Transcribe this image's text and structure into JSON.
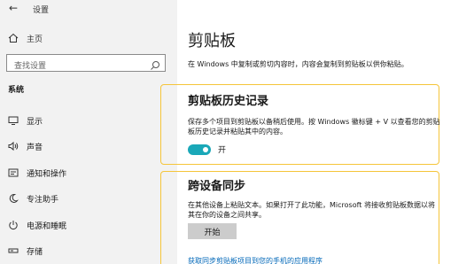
{
  "window": {
    "title": "设置",
    "back_icon": "back-arrow-icon"
  },
  "sidebar": {
    "home_label": "主页",
    "search_placeholder": "查找设置",
    "section_header": "系统",
    "items": [
      {
        "label": "显示",
        "icon": "monitor-icon"
      },
      {
        "label": "声音",
        "icon": "speaker-icon"
      },
      {
        "label": "通知和操作",
        "icon": "notification-icon"
      },
      {
        "label": "专注助手",
        "icon": "moon-icon"
      },
      {
        "label": "电源和睡眠",
        "icon": "power-icon"
      },
      {
        "label": "存储",
        "icon": "storage-icon"
      }
    ]
  },
  "main": {
    "title": "剪贴板",
    "description": "在 Windows 中复制或剪切内容时，内容会复制到剪贴板以供你粘贴。",
    "history": {
      "title": "剪贴板历史记录",
      "description": "保存多个项目到剪贴板以备稍后使用。按 Windows 徽标键 + V 以查看您的剪贴板历史记录并粘贴其中的内容。",
      "toggle_label": "开",
      "toggle_on": true,
      "accent": "#1aa8b8"
    },
    "sync": {
      "title": "跨设备同步",
      "description": "在其他设备上粘贴文本。如果打开了此功能，Microsoft 将接收剪贴板数据以将其在你的设备之间共享。",
      "button_label": "开始",
      "link_text": "获取同步剪贴板项目到您的手机的应用程序"
    },
    "highlight_color": "#f5c53a"
  }
}
